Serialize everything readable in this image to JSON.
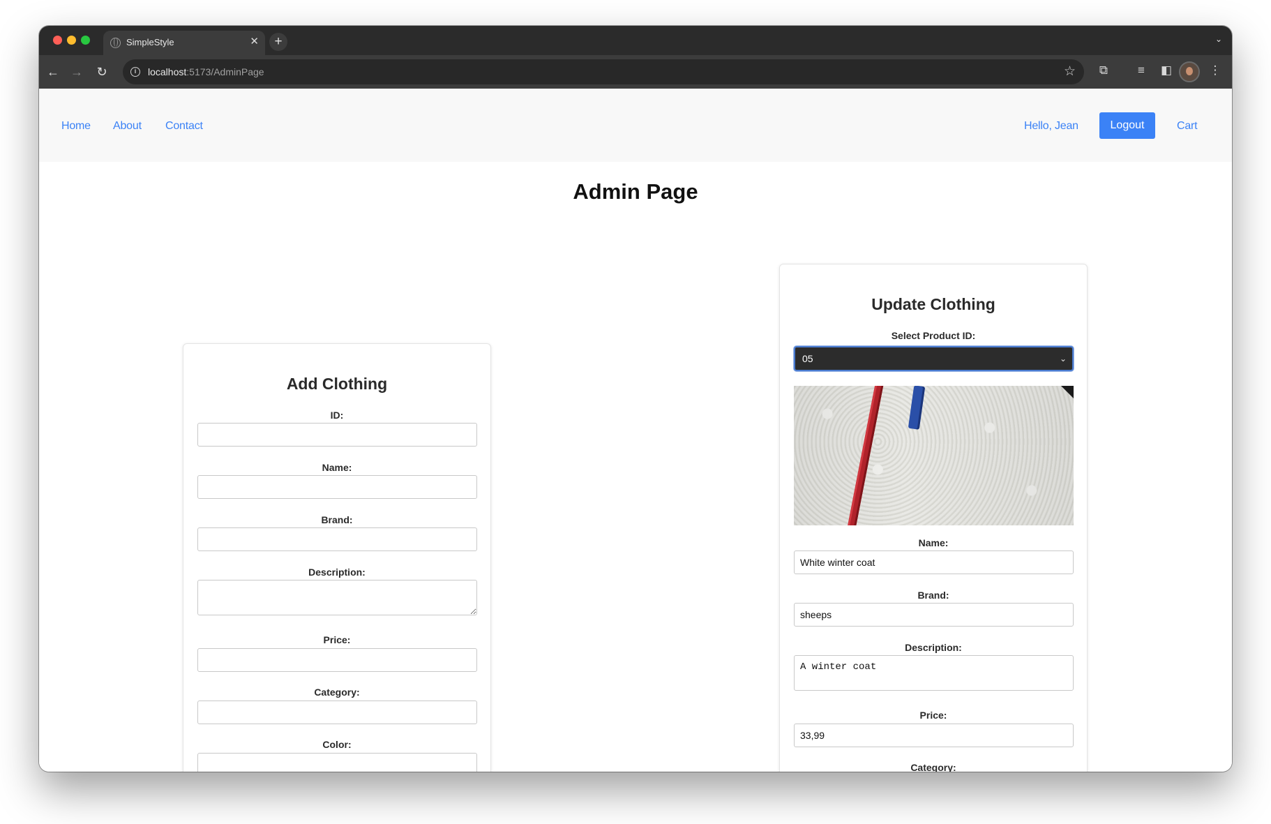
{
  "browser": {
    "tab_title": "SimpleStyle",
    "tab_close": "✕",
    "new_tab": "+",
    "tabs_dropdown": "⌄",
    "url_host": "localhost",
    "url_path": ":5173/AdminPage"
  },
  "nav": {
    "home": "Home",
    "about": "About",
    "contact": "Contact",
    "greeting": "Hello, Jean",
    "logout": "Logout",
    "cart": "Cart"
  },
  "page": {
    "title": "Admin Page"
  },
  "add_form": {
    "title": "Add Clothing",
    "id_label": "ID:",
    "name_label": "Name:",
    "brand_label": "Brand:",
    "description_label": "Description:",
    "price_label": "Price:",
    "category_label": "Category:",
    "color_label": "Color:"
  },
  "update_form": {
    "title": "Update Clothing",
    "select_label": "Select Product ID:",
    "selected_id": "05",
    "name_label": "Name:",
    "name_value": "White winter coat",
    "brand_label": "Brand:",
    "brand_value": "sheeps",
    "description_label": "Description:",
    "description_value": "A winter coat",
    "price_label": "Price:",
    "price_value": "33,99",
    "category_label": "Category:"
  },
  "colors": {
    "accent": "#3b82f6",
    "zipper": "#b0222a",
    "zip_tag": "#2a4fa8"
  },
  "icons": [
    "back-arrow-icon",
    "forward-arrow-icon",
    "reload-icon",
    "site-info-icon",
    "bookmark-star-icon",
    "extensions-icon",
    "media-controls-icon",
    "side-panel-icon",
    "profile-avatar",
    "more-menu-icon"
  ]
}
